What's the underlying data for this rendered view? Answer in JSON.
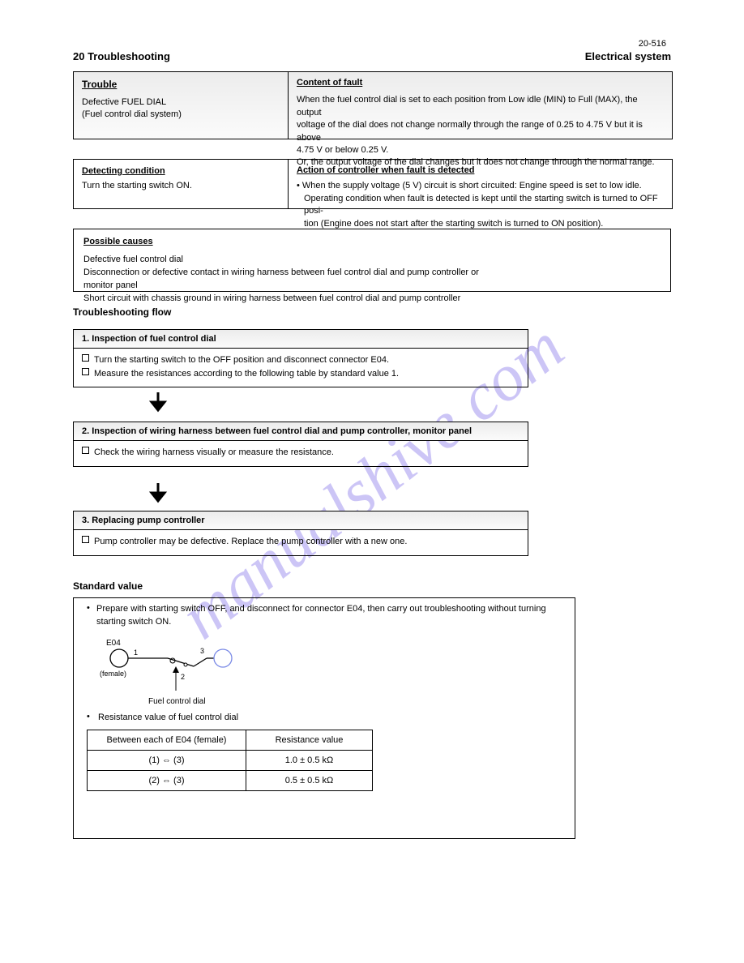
{
  "page_number": "20-516",
  "section_title": "20 Troubleshooting",
  "section_sub": "Electrical system",
  "trouble": {
    "label": "Trouble",
    "body_line1": "Defective FUEL DIAL",
    "body_line2": "(Fuel control dial system)"
  },
  "fault": {
    "label": "Content of fault",
    "lines": [
      "When the fuel control dial is set to each position from Low idle (MIN) to Full (MAX), the output",
      "voltage of the dial does not change normally through the range of 0.25 to 4.75 V but it is above",
      "4.75 V or below 0.25 V.",
      "Or, the output voltage of the dial changes but it does not change through the normal range."
    ]
  },
  "condition": {
    "label": "Detecting condition",
    "body": "Turn the starting switch ON."
  },
  "action": {
    "label": "Action of controller when fault is detected",
    "lines": [
      "When the supply voltage (5 V) circuit is short circuited: Engine speed is set to low idle.",
      "Operating condition when fault is detected is kept until the starting switch is turned to OFF posi-",
      "tion (Engine does not start after the starting switch is turned to ON position)."
    ]
  },
  "cause": {
    "label": "Possible causes",
    "lines": [
      "Defective fuel control dial",
      "Disconnection or defective contact in wiring harness between fuel control dial and pump controller or",
      "monitor panel",
      "Short circuit with chassis ground in wiring harness between fuel control dial and pump controller"
    ]
  },
  "flow_title": "Troubleshooting flow",
  "steps": [
    {
      "head": "1. Inspection of fuel control dial",
      "items": [
        "Turn the starting switch to the OFF position and disconnect connector E04.",
        "Measure the resistances according to the following table by standard value 1."
      ]
    },
    {
      "head": "2. Inspection of wiring harness between fuel control dial and pump controller, monitor panel",
      "items": [
        "Check the wiring harness visually or measure the resistance."
      ]
    },
    {
      "head": "3. Replacing pump controller",
      "items": [
        "Pump controller may be defective. Replace the pump controller with a new one."
      ]
    }
  ],
  "std_title": "Standard value",
  "circuit_labels": {
    "e04_left": "E04",
    "female": "(female)",
    "f1": "1",
    "f2": "2",
    "f3": "3",
    "dial": "Fuel control dial"
  },
  "std_intro": "Prepare with starting switch OFF, and disconnect for connector E04, then carry out troubleshooting without turning starting switch ON.",
  "std_resist": "Resistance value of fuel control dial",
  "std_table": {
    "head1": "Between each of E04 (female)",
    "head2": "Resistance value",
    "row1a": "(1)  ⇔  (3)",
    "row1b": "1.0 ± 0.5 kΩ",
    "row2a": "(2)  ⇔  (3)",
    "row2b": "0.5 ± 0.5 kΩ"
  },
  "watermark": "manualshive.com"
}
